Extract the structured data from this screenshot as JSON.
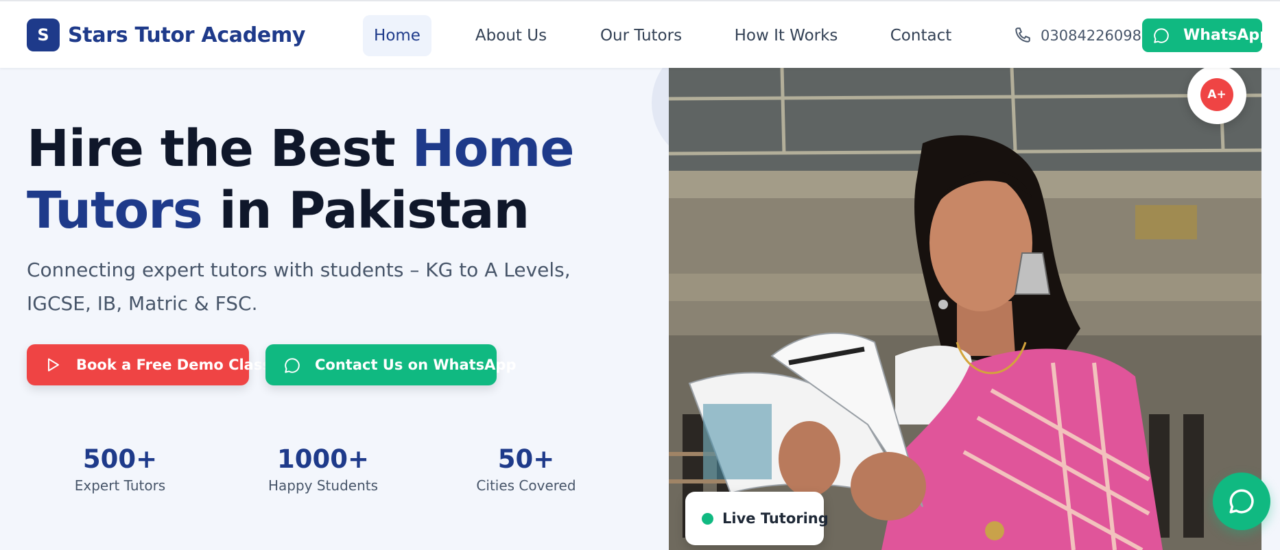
{
  "header": {
    "logo_letter": "S",
    "brand": "Stars Tutor Academy",
    "nav": [
      {
        "label": "Home",
        "active": true
      },
      {
        "label": "About Us",
        "active": false
      },
      {
        "label": "Our Tutors",
        "active": false
      },
      {
        "label": "How It Works",
        "active": false
      },
      {
        "label": "Contact",
        "active": false
      }
    ],
    "phone": "03084226098",
    "whatsapp_label": "WhatsApp"
  },
  "hero": {
    "title_part1": "Hire the Best ",
    "title_accent1": "Home",
    "title_accent2": "Tutors",
    "title_part2": " in Pakistan",
    "subtitle": "Connecting expert tutors with students – KG to A Levels, IGCSE, IB, Matric & FSC.",
    "demo_button": "Book a Free Demo Class",
    "whatsapp_button": "Contact Us on WhatsApp",
    "stats": [
      {
        "value": "500+",
        "label": "Expert Tutors"
      },
      {
        "value": "1000+",
        "label": "Happy Students"
      },
      {
        "value": "50+",
        "label": "Cities Covered"
      }
    ],
    "badge": "A+",
    "live_label": "Live Tutoring"
  },
  "colors": {
    "primary": "#1e3a8a",
    "red": "#ef4444",
    "green": "#10b981",
    "background": "#f3f6fc"
  },
  "icons": [
    "phone-icon",
    "whatsapp-icon",
    "play-icon",
    "chat-bubble-icon"
  ]
}
